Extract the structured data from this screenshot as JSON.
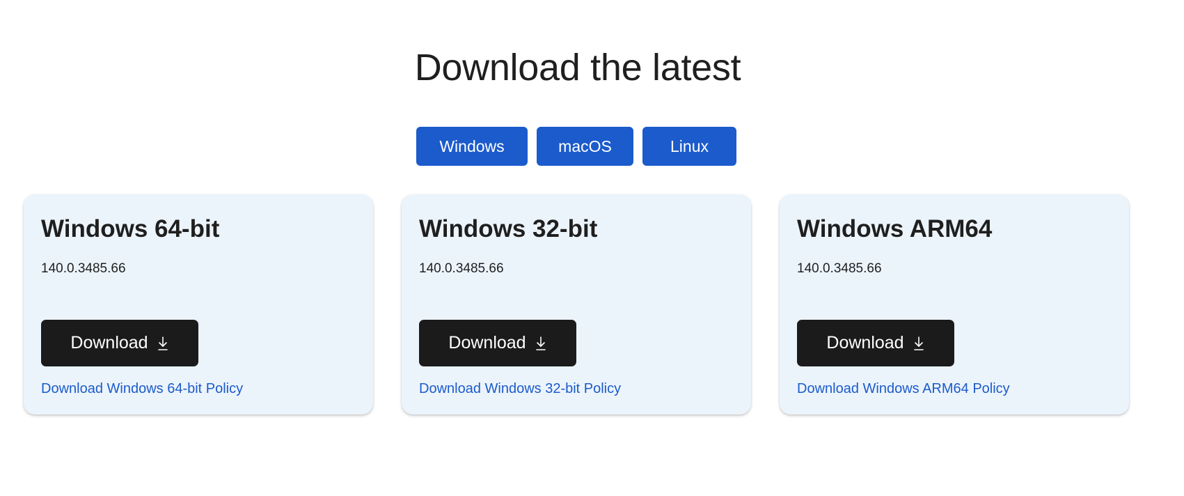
{
  "heading": "Download the latest",
  "platform_tabs": [
    {
      "label": "Windows"
    },
    {
      "label": "macOS"
    },
    {
      "label": "Linux"
    }
  ],
  "cards": [
    {
      "title": "Windows 64-bit",
      "version": "140.0.3485.66",
      "button_label": "Download",
      "button_icon": "download-arrow-icon",
      "policy_link": "Download Windows 64-bit Policy"
    },
    {
      "title": "Windows 32-bit",
      "version": "140.0.3485.66",
      "button_label": "Download",
      "button_icon": "download-arrow-icon",
      "policy_link": "Download Windows 32-bit Policy"
    },
    {
      "title": "Windows ARM64",
      "version": "140.0.3485.66",
      "button_label": "Download",
      "button_icon": "download-arrow-icon",
      "policy_link": "Download Windows ARM64 Policy"
    }
  ],
  "colors": {
    "accent": "#1b5bcc",
    "card_background": "#ecf4fb",
    "button_background": "#1b1b1b",
    "text": "#1f1f1f"
  }
}
